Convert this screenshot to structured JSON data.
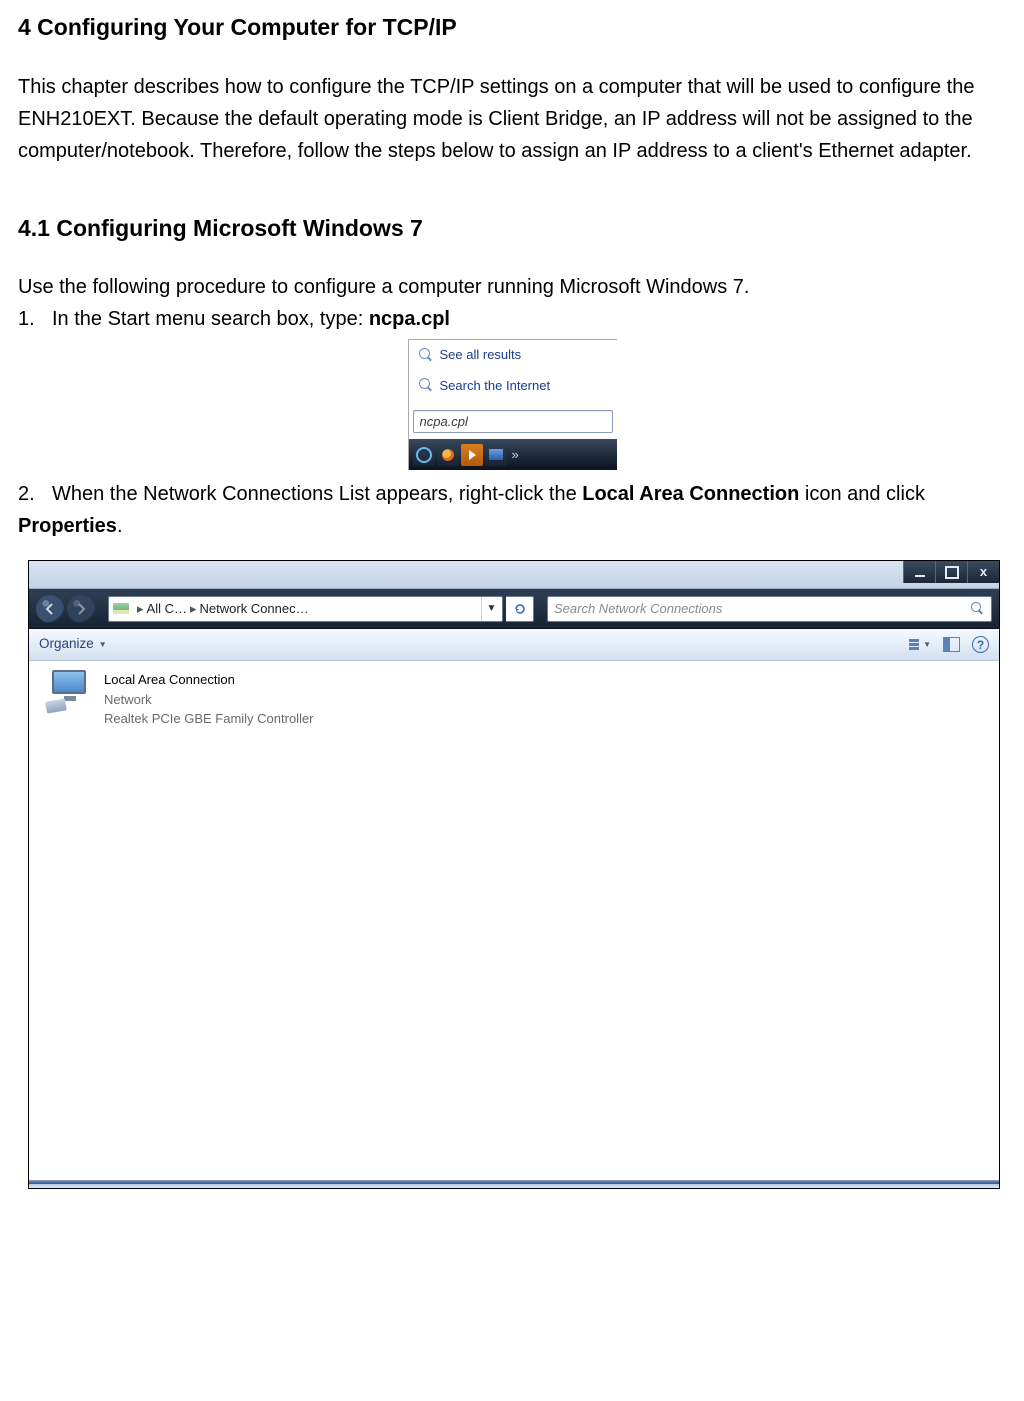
{
  "chapter": {
    "title": "4 Configuring Your Computer for TCP/IP",
    "intro": "This chapter describes how to configure the TCP/IP settings on a computer that will be used to configure the ENH210EXT. Because the default operating mode is Client Bridge, an IP address will not be assigned to the computer/notebook. Therefore, follow the steps below to assign an IP address to a client's Ethernet adapter."
  },
  "section": {
    "title": "4.1 Configuring Microsoft Windows 7",
    "lead": "Use the following procedure to configure a computer running Microsoft Windows 7.",
    "step1_num": "1.",
    "step1_text": "In the Start menu search box, type: ",
    "step1_bold": "ncpa.cpl",
    "step2_num": "2.",
    "step2_pre": "When the Network Connections List appears, right-click the ",
    "step2_bold1": "Local Area Connection",
    "step2_mid": " icon and click ",
    "step2_bold2": "Properties",
    "step2_post": "."
  },
  "fig1": {
    "see_all": "See all results",
    "search_internet": "Search the Internet",
    "input_value": "ncpa.cpl",
    "taskbar_chevron": "»"
  },
  "fig2": {
    "breadcrumb_seg1": "All C…",
    "breadcrumb_seg2": "Network Connec…",
    "search_placeholder": "Search Network Connections",
    "organize": "Organize",
    "connection_title": "Local Area Connection",
    "connection_status": "Network",
    "connection_device": "Realtek PCIe GBE Family Controller",
    "close_x": "x",
    "help_q": "?"
  }
}
